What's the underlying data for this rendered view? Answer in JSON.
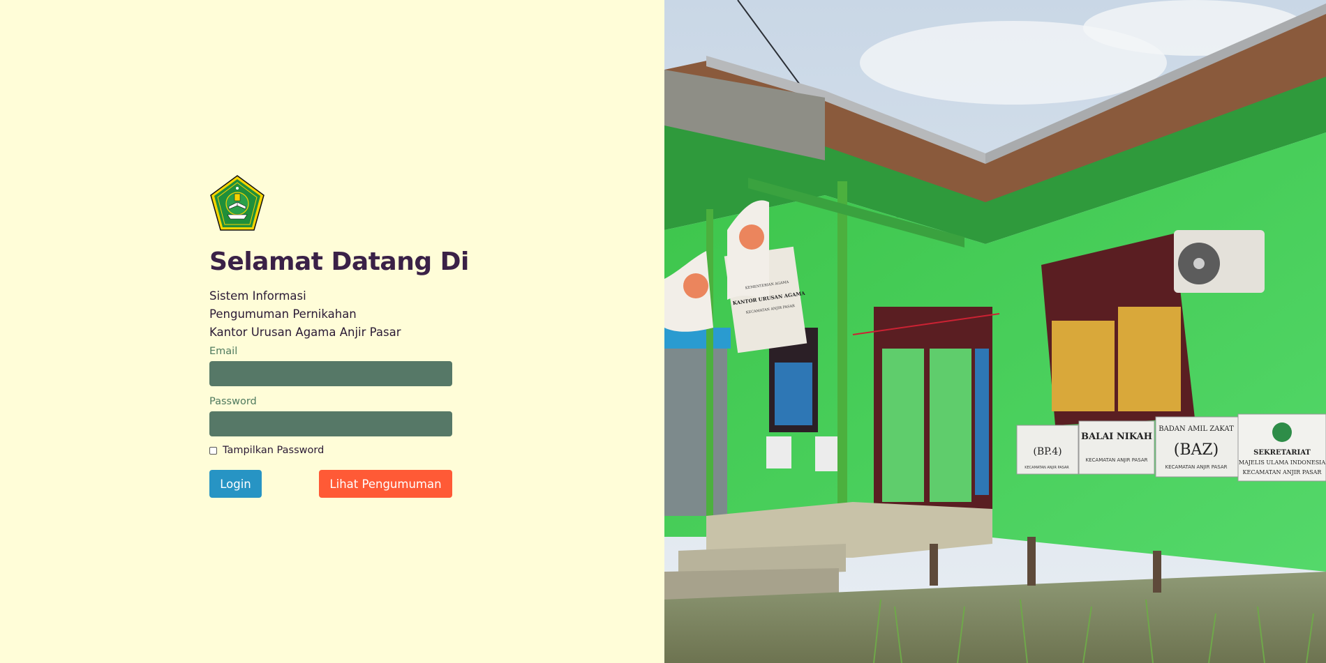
{
  "welcome_title": "Selamat Datang Di",
  "subtitle_lines": [
    "Sistem Informasi",
    "Pengumuman Pernikahan",
    "Kantor Urusan Agama Anjir Pasar"
  ],
  "form": {
    "email_label": "Email",
    "email_value": "",
    "password_label": "Password",
    "password_value": "",
    "show_password_label": "Tampilkan Password"
  },
  "buttons": {
    "login": "Login",
    "view_announcement": "Lihat Pengumuman"
  },
  "photo": {
    "signs": {
      "kua": [
        "KEMENTERIAN AGAMA",
        "KANTOR URUSAN AGAMA",
        "KECAMATAN ANJIR PASAR"
      ],
      "bp4": [
        "(BP.4)",
        "KECAMATAN ANJIR PASAR"
      ],
      "balai_nikah": [
        "BALAI NIKAH",
        "KECAMATAN ANJIR PASAR"
      ],
      "baz": [
        "BADAN AMIL ZAKAT",
        "(BAZ)",
        "KECAMATAN ANJIR PASAR"
      ],
      "mui": [
        "SEKRETARIAT",
        "MAJELIS ULAMA INDONESIA",
        "KECAMATAN ANJIR PASAR"
      ]
    }
  },
  "colors": {
    "background": "#fffdd8",
    "title": "#3a2147",
    "input_bg": "#567867",
    "login_button": "#2794c4",
    "announce_button": "#ff5a36"
  }
}
